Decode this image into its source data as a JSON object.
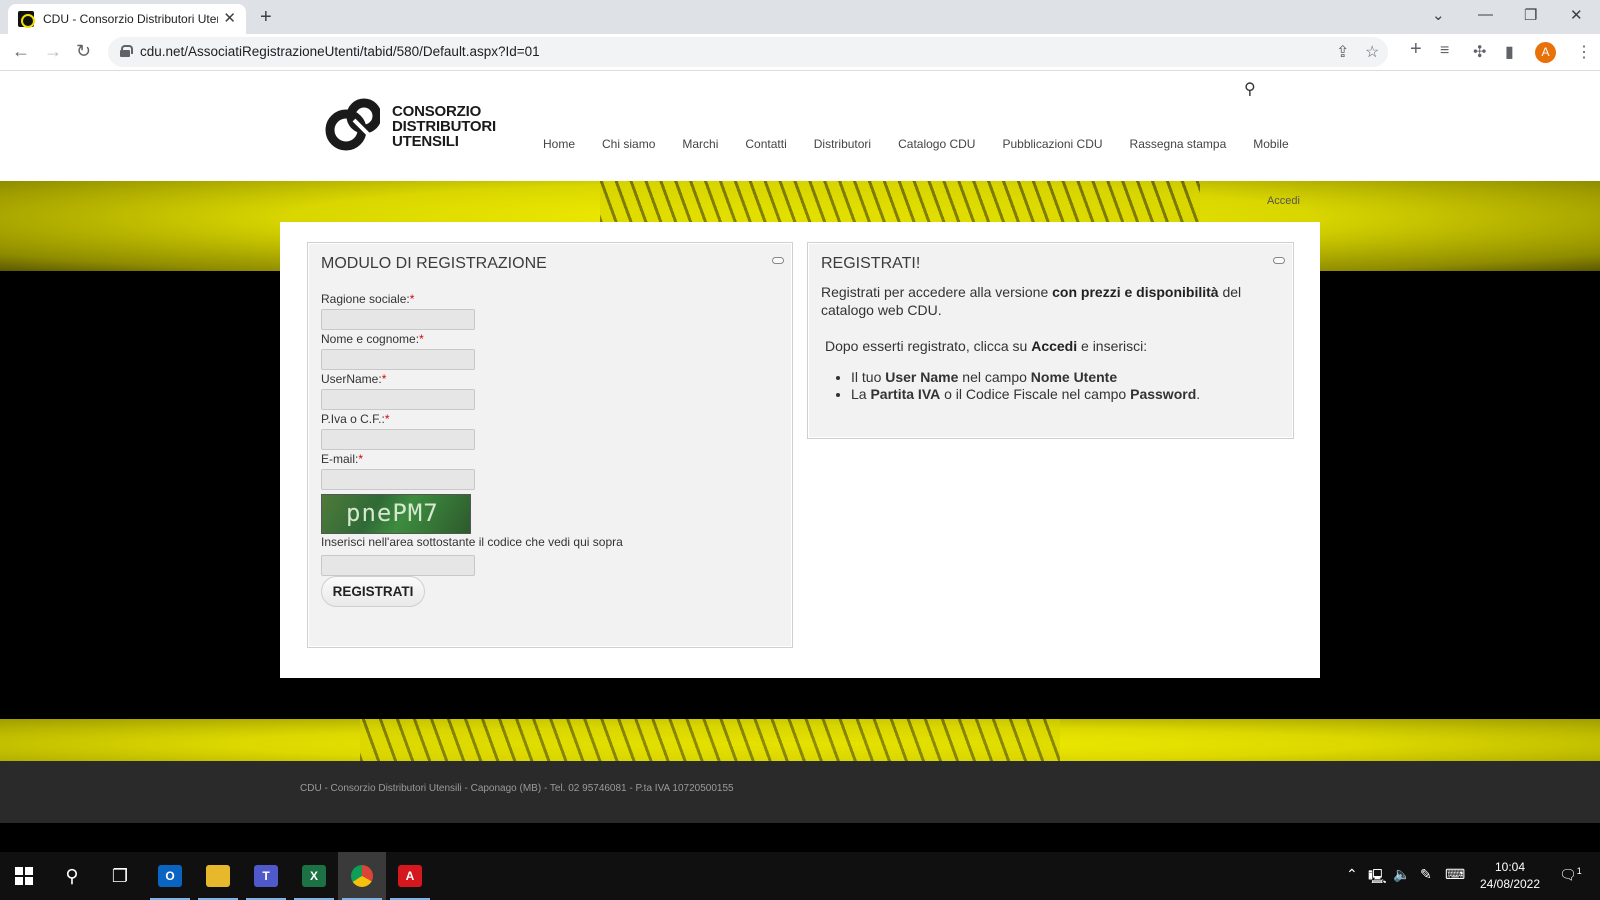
{
  "browser": {
    "tab_title": "CDU - Consorzio Distributori Utensili",
    "url": "cdu.net/AssociatiRegistrazioneUtenti/tabid/580/Default.aspx?Id=01",
    "profile_initial": "A"
  },
  "site": {
    "logo_lines": [
      "CONSORZIO",
      "DISTRIBUTORI",
      "UTENSILI"
    ],
    "nav": [
      "Home",
      "Chi siamo",
      "Marchi",
      "Contatti",
      "Distributori",
      "Catalogo CDU",
      "Pubblicazioni CDU",
      "Rassegna stampa",
      "Mobile"
    ],
    "login_link": "Accedi",
    "footer": "CDU - Consorzio Distributori Utensili - Caponago (MB) - Tel. 02 95746081 - P.ta IVA 10720500155"
  },
  "form": {
    "title": "MODULO DI REGISTRAZIONE",
    "fields": [
      {
        "label": "Ragione sociale:",
        "value": ""
      },
      {
        "label": "Nome e cognome:",
        "value": ""
      },
      {
        "label": "UserName:",
        "value": ""
      },
      {
        "label": "P.Iva o C.F.:",
        "value": ""
      },
      {
        "label": "E-mail:",
        "value": ""
      }
    ],
    "required_mark": "*",
    "captcha_text": "pnePM7",
    "captcha_hint": "Inserisci nell'area sottostante il codice che vedi qui sopra",
    "captcha_value": "",
    "submit_label": "REGISTRATI"
  },
  "info": {
    "title": "REGISTRATI!",
    "p1_a": "Registrati per accedere alla versione ",
    "p1_b": "con prezzi e disponibilità",
    "p1_c": " del catalogo web CDU.",
    "p2_a": "Dopo esserti registrato, clicca su ",
    "p2_b": "Accedi",
    "p2_c": " e inserisci:",
    "li1": [
      "Il tuo ",
      "User Name",
      " nel campo ",
      "Nome Utente"
    ],
    "li2": [
      "La ",
      "Partita IVA",
      " o il Codice Fiscale nel campo ",
      "Password",
      "."
    ]
  },
  "taskbar": {
    "time": "10:04",
    "date": "24/08/2022",
    "notification_count": "1",
    "apps": [
      "outlook",
      "file-explorer",
      "teams",
      "excel",
      "chrome",
      "acrobat"
    ]
  }
}
